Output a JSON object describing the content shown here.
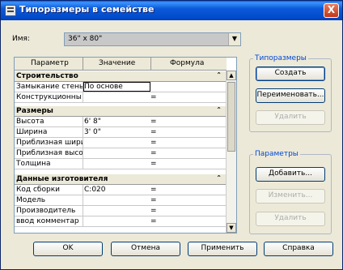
{
  "window": {
    "title": "Типоразмеры в семействе",
    "close_glyph": "X"
  },
  "name_field": {
    "label": "Имя:",
    "value": "36\" x 80\""
  },
  "grid": {
    "headers": {
      "parameter": "Параметр",
      "value": "Значение",
      "formula": "Формула"
    },
    "groups": [
      {
        "title": "Строительство",
        "rows": [
          {
            "param": "Замыкание стены",
            "value": "По основе",
            "formula": ""
          },
          {
            "param": "Конструкционны",
            "value": "",
            "formula": "="
          }
        ]
      },
      {
        "title": "Размеры",
        "rows": [
          {
            "param": "Высота",
            "value": "6'  8\"",
            "formula": "="
          },
          {
            "param": "Ширина",
            "value": "3'  0\"",
            "formula": "="
          },
          {
            "param": "Приблизная ширин",
            "value": "",
            "formula": "="
          },
          {
            "param": "Приблизная высот",
            "value": "",
            "formula": "="
          },
          {
            "param": "Толщина",
            "value": "",
            "formula": "="
          }
        ]
      },
      {
        "title": "Данные изготовителя",
        "rows": [
          {
            "param": "Код сборки",
            "value": "C:020",
            "formula": "="
          },
          {
            "param": "Модель",
            "value": "",
            "formula": "="
          },
          {
            "param": "Производитель",
            "value": "",
            "formula": "="
          },
          {
            "param": "ввод комментар",
            "value": "",
            "formula": "="
          }
        ]
      }
    ]
  },
  "types_group": {
    "legend": "Типоразмеры",
    "new": "Создать",
    "rename": "Переименовать...",
    "delete": "Удалить"
  },
  "params_group": {
    "legend": "Параметры",
    "add": "Добавить...",
    "modify": "Изменить...",
    "remove": "Удалить"
  },
  "footer": {
    "ok": "OK",
    "cancel": "Отмена",
    "apply": "Применить",
    "help": "Справка"
  }
}
